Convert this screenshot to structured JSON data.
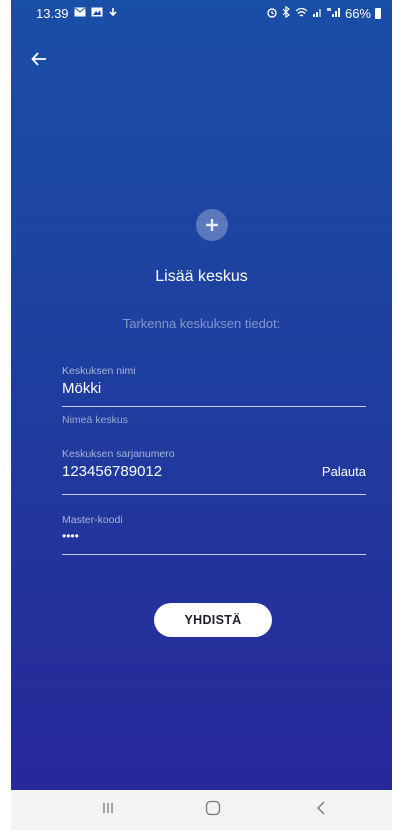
{
  "status_bar": {
    "time": "13.39",
    "battery": "66%",
    "icons_left": [
      "message-icon",
      "gallery-icon",
      "download-icon"
    ],
    "icons_right": [
      "alarm-icon",
      "bluetooth-icon",
      "wifi-icon",
      "signal-icon",
      "4g-signal-icon",
      "battery-icon"
    ]
  },
  "header": {
    "back_icon": "arrow-left-icon"
  },
  "main": {
    "add_icon": "plus-circle-icon",
    "title": "Lisää keskus",
    "subtitle": "Tarkenna keskuksen tiedot:",
    "fields": {
      "name": {
        "label": "Keskuksen nimi",
        "value": "Mökki",
        "helper": "Nimeä keskus"
      },
      "serial": {
        "label": "Keskuksen sarjanumero",
        "value": "123456789012",
        "action": "Palauta"
      },
      "master": {
        "label": "Master-koodi",
        "value": "••••"
      }
    },
    "connect_label": "YHDISTÄ"
  },
  "nav_bar": {
    "items": [
      "recents-icon",
      "home-icon",
      "back-icon"
    ]
  },
  "colors": {
    "gradient_top": "#1a4fa6",
    "gradient_bottom": "#27289a",
    "accent": "#ffffff"
  }
}
